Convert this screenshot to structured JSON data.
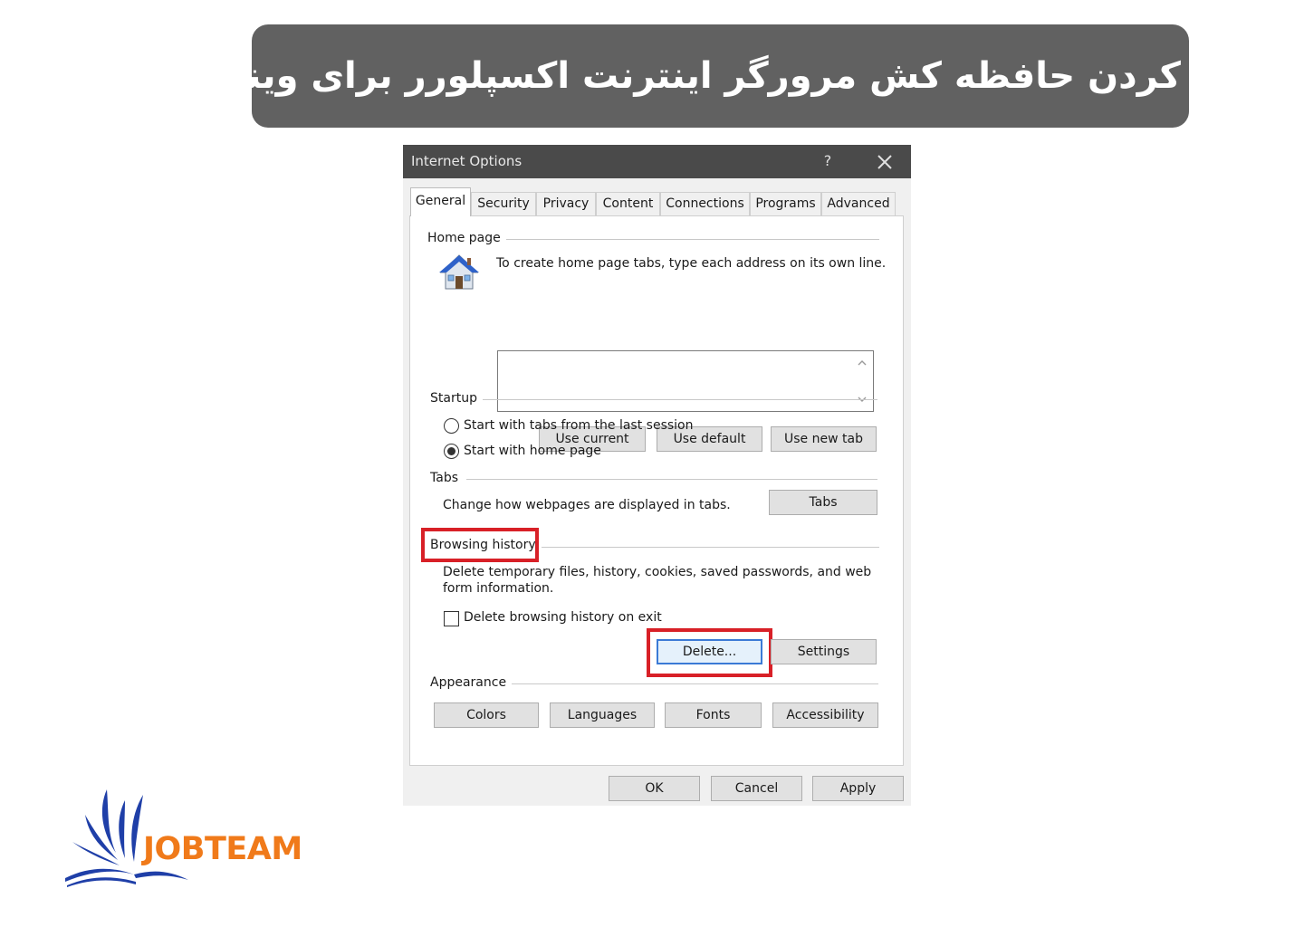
{
  "banner": {
    "title": "پاک کردن حافظه کش مرورگر اینترنت اکسپلورر  برای ویندوز"
  },
  "dialog": {
    "title": "Internet Options",
    "help_label": "?",
    "tabs": [
      {
        "label": "General",
        "active": true
      },
      {
        "label": "Security"
      },
      {
        "label": "Privacy"
      },
      {
        "label": "Content"
      },
      {
        "label": "Connections"
      },
      {
        "label": "Programs"
      },
      {
        "label": "Advanced"
      }
    ],
    "home_page": {
      "label": "Home page",
      "instructions": "To create home page tabs, type each address on its own line.",
      "address_value": "",
      "icon": "house-icon",
      "buttons": {
        "use_current": "Use current",
        "use_default": "Use default",
        "use_new_tab": "Use new tab"
      }
    },
    "startup": {
      "label": "Startup",
      "options": [
        {
          "label": "Start with tabs from the last session",
          "selected": false
        },
        {
          "label": "Start with home page",
          "selected": true
        }
      ]
    },
    "tabs_group": {
      "label": "Tabs",
      "description": "Change how webpages are displayed in tabs.",
      "button": "Tabs"
    },
    "browsing_history": {
      "label": "Browsing history",
      "description_line1": "Delete temporary files, history, cookies, saved passwords, and web",
      "description_line2": "form information.",
      "checkbox_label": "Delete browsing history on exit",
      "checkbox_checked": false,
      "delete_button": "Delete...",
      "settings_button": "Settings"
    },
    "appearance": {
      "label": "Appearance",
      "buttons": {
        "colors": "Colors",
        "languages": "Languages",
        "fonts": "Fonts",
        "accessibility": "Accessibility"
      }
    },
    "footer": {
      "ok": "OK",
      "cancel": "Cancel",
      "apply": "Apply"
    }
  },
  "logo": {
    "text": "JOBTEAM"
  },
  "colors": {
    "banner_bg": "#616161",
    "titlebar_bg": "#4a4a4a",
    "highlight_red": "#d82027",
    "logo_orange": "#f07a1a",
    "logo_blue": "#1f3fa8"
  }
}
